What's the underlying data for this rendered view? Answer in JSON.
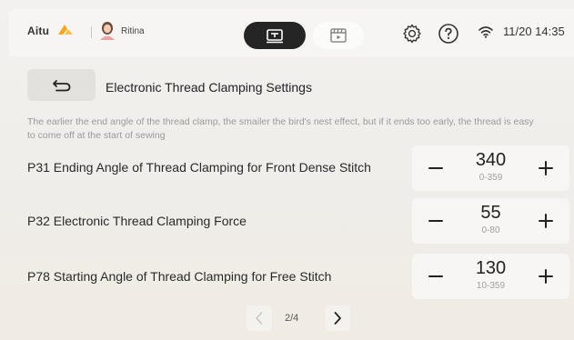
{
  "header": {
    "brand": "Aitu",
    "username": "Ritina",
    "datetime": "11/20 14:35"
  },
  "page": {
    "title": "Electronic Thread Clamping Settings",
    "description": "The earlier the end angle of the thread clamp, the smailer the bird's nest effect, but if it ends too early, the thread is easy to come off at the start of sewing"
  },
  "params": [
    {
      "label": "P31 Ending Angle of Thread Clamping for Front Dense Stitch",
      "value": "340",
      "range": "0-359"
    },
    {
      "label": "P32 Electronic Thread Clamping Force",
      "value": "55",
      "range": "0-80"
    },
    {
      "label": "P78 Starting Angle of Thread Clamping for Free Stitch",
      "value": "130",
      "range": "10-359"
    }
  ],
  "pagination": {
    "text": "2/4"
  },
  "colors": {
    "brand_orange": "#f5a623",
    "dark_toggle": "#252525"
  }
}
